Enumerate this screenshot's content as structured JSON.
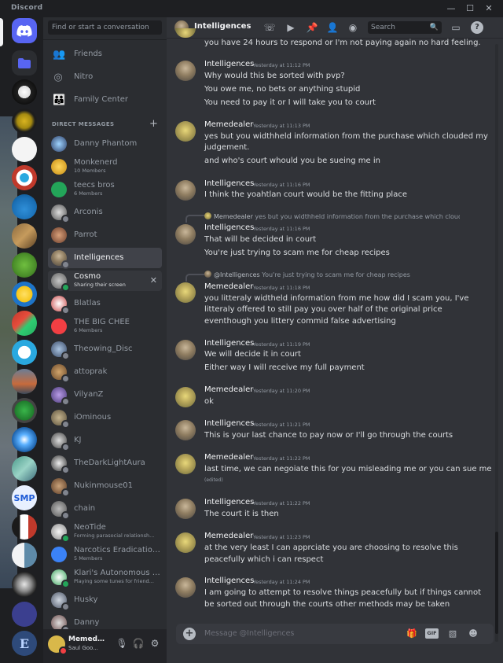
{
  "app": {
    "title": "Discord"
  },
  "dm_panel": {
    "search_placeholder": "Find or start a conversation",
    "nav": [
      {
        "label": "Friends",
        "icon": "friends-icon"
      },
      {
        "label": "Nitro",
        "icon": "nitro-icon"
      },
      {
        "label": "Family Center",
        "icon": "family-center-icon"
      }
    ],
    "section_header": "DIRECT MESSAGES",
    "items": [
      {
        "name": "Danny Phantom",
        "sub": ""
      },
      {
        "name": "Monkenerd",
        "sub": "10 Members"
      },
      {
        "name": "teecs bros",
        "sub": "6 Members"
      },
      {
        "name": "Arconis",
        "sub": ""
      },
      {
        "name": "Parrot",
        "sub": ""
      },
      {
        "name": "Intelligences",
        "sub": ""
      },
      {
        "name": "Cosmo",
        "sub": "Sharing their screen"
      },
      {
        "name": "Blatlas",
        "sub": ""
      },
      {
        "name": "THE BIG CHEE",
        "sub": "6 Members"
      },
      {
        "name": "Theowing_Disc",
        "sub": ""
      },
      {
        "name": "attoprak",
        "sub": ""
      },
      {
        "name": "VilyanZ",
        "sub": ""
      },
      {
        "name": "iOminous",
        "sub": ""
      },
      {
        "name": "KJ",
        "sub": ""
      },
      {
        "name": "TheDarkLightAura",
        "sub": ""
      },
      {
        "name": "Nukinmouse01",
        "sub": ""
      },
      {
        "name": "chain",
        "sub": ""
      },
      {
        "name": "NeoTide",
        "sub": "Forming parasocial relationsh..."
      },
      {
        "name": "Narcotics Eradication...",
        "sub": "5 Members"
      },
      {
        "name": "Klari's Autonomous B...",
        "sub": "Playing some tunes for friend..."
      },
      {
        "name": "Husky",
        "sub": ""
      },
      {
        "name": "Danny",
        "sub": ""
      }
    ]
  },
  "user": {
    "name": "Memedeal...",
    "status": "Saul Goo..."
  },
  "channel": {
    "title": "Intelligences",
    "search_placeholder": "Search",
    "composer_placeholder": "Message @Intelligences",
    "gif_label": "GIF"
  },
  "messages": [
    {
      "text": "you have 24 hours to respond or I'm not paying again no hard feeling."
    },
    {
      "author": "Intelligences",
      "time": "Yesterday at 11:12 PM",
      "lines": [
        "Why would this be sorted with pvp?",
        "You owe me, no bets or anything stupid",
        "You need to pay it or I will take you to court"
      ]
    },
    {
      "author": "Memedealer",
      "time": "Yesterday at 11:13 PM",
      "lines": [
        "yes but you widthheld information from the purchase which clouded my",
        "judgement.",
        "and who's court whould you be sueing me in"
      ]
    },
    {
      "author": "Intelligences",
      "time": "Yesterday at 11:16 PM",
      "lines": [
        "I think the yoahtlan court would be the fitting place"
      ]
    },
    {
      "reply_author": "Memedealer",
      "reply_text": "yes but you widthheld information from the purchase which clouded my judgement.",
      "author": "Intelligences",
      "time": "Yesterday at 11:16 PM",
      "lines": [
        "That will be decided in court",
        "You're just trying to scam me for cheap recipes"
      ]
    },
    {
      "reply_author": "@Intelligences",
      "reply_text": "You're just trying to scam me for cheap recipes",
      "author": "Memedealer",
      "time": "Yesterday at 11:18 PM",
      "lines": [
        "you litteraly widtheld information from me how did I scam you, I've",
        "litteraly offered to still pay you over half of the original price",
        "eventhough you littery commid false advertising"
      ]
    },
    {
      "author": "Intelligences",
      "time": "Yesterday at 11:19 PM",
      "lines": [
        "We will decide it in court",
        "Either way I will receive my full payment"
      ]
    },
    {
      "author": "Memedealer",
      "time": "Yesterday at 11:20 PM",
      "lines": [
        "ok"
      ]
    },
    {
      "author": "Intelligences",
      "time": "Yesterday at 11:21 PM",
      "lines": [
        "This is your last chance to pay now or I'll go through the courts"
      ]
    },
    {
      "author": "Memedealer",
      "time": "Yesterday at 11:22 PM",
      "lines": [
        "last time, we can negoiate this for you misleading me or you can sue me"
      ],
      "edited": "(edited)"
    },
    {
      "author": "Intelligences",
      "time": "Yesterday at 11:22 PM",
      "lines": [
        "The court it is then"
      ]
    },
    {
      "author": "Memedealer",
      "time": "Yesterday at 11:23 PM",
      "lines": [
        "at the very least I can apprciate you are choosing to resolve this",
        "peacefully which i can respect"
      ]
    },
    {
      "author": "Intelligences",
      "time": "Yesterday at 11:24 PM",
      "lines": [
        "I am going to attempt to resolve things peacefully but if things cannot",
        "be sorted out through the courts other methods may be taken"
      ]
    }
  ]
}
